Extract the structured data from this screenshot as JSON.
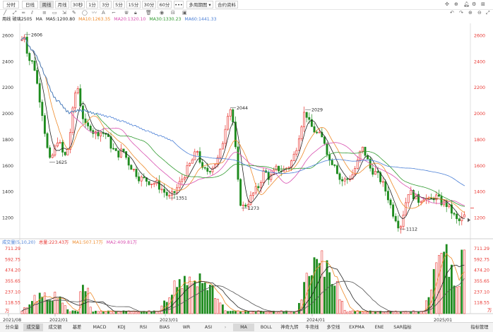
{
  "toolbar": {
    "periods": [
      "分时",
      "日线",
      "周线",
      "月线",
      "30秒",
      "1分",
      "3分",
      "5分",
      "15分",
      "30分",
      "60分"
    ],
    "active_period": "周线",
    "more_label": "•••",
    "chart_type": "多周期图",
    "contract_info": "合约资料"
  },
  "info": {
    "symbol": "周线 玻璃2505",
    "ma_prefix": "MA",
    "ma5": "MA5:1200.80",
    "ma10": "MA10:1263.35",
    "ma20": "MA20:1320.10",
    "ma30": "MA30:1330.23",
    "ma60": "MA60:1441.33"
  },
  "vol_info": {
    "title": "成交量(5,10,20)",
    "vol": "总量:223.43万",
    "ma1": "MA1:507.17万",
    "ma2": "MA2:409.81万"
  },
  "price_axis": {
    "ticks": [
      "2600",
      "2400",
      "2200",
      "2000",
      "1800",
      "1600",
      "1400",
      "1200"
    ],
    "current": "1273"
  },
  "vol_axis": {
    "ticks": [
      "711.29",
      "592.75",
      "474.20",
      "355.65",
      "237.10",
      "118.55",
      "万"
    ]
  },
  "dates": [
    "2021/08",
    "2022/01",
    "2023/01",
    "2024/01",
    "2025/01"
  ],
  "annotations": [
    "2606",
    "1625",
    "2044",
    "1351",
    "1273",
    "2029",
    "1112"
  ],
  "colors": {
    "up": "#e8342f",
    "down": "#1e8b1e",
    "ma5": "#222222",
    "ma10": "#ee8a2a",
    "ma20": "#d850b0",
    "ma30": "#2f9a2f",
    "ma60": "#4a7fd6"
  },
  "bottom_tabs": [
    "分众量",
    "成交量",
    "成交额",
    "基差",
    "MACD",
    "KDJ",
    "RSI",
    "BIAS",
    "WR",
    "ASI"
  ],
  "bottom_tabs2": [
    "MA",
    "BOLL",
    "神奇九转",
    "牛熊线",
    "多空线",
    "EXPMA",
    "ENE",
    "SAR指标",
    "指标管理"
  ],
  "chart_data": {
    "type": "candlestick",
    "title": "周线 玻璃2505",
    "x": [
      "2021/08",
      "2022/01",
      "2023/01",
      "2024/01",
      "2025/01"
    ],
    "ylim": [
      1100,
      2650
    ],
    "series": [
      {
        "name": "MA5",
        "values": [
          1200.8
        ]
      },
      {
        "name": "MA10",
        "values": [
          1263.35
        ]
      },
      {
        "name": "MA20",
        "values": [
          1320.1
        ]
      },
      {
        "name": "MA30",
        "values": [
          1330.23
        ]
      },
      {
        "name": "MA60",
        "values": [
          1441.33
        ]
      }
    ],
    "annotations": [
      2606,
      1625,
      2044,
      1351,
      1273,
      2029,
      1112
    ],
    "volume": {
      "max": 711.29,
      "total": "223.43万",
      "ma1": "507.17万",
      "ma2": "409.81万"
    }
  }
}
